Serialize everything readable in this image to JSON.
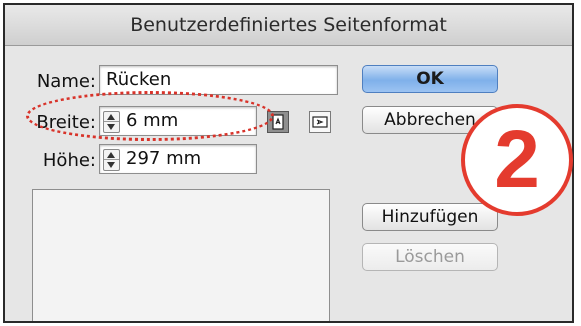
{
  "dialog": {
    "title": "Benutzerdefiniertes Seitenformat"
  },
  "form": {
    "name_label": "Name:",
    "name_value": "Rücken",
    "width_label": "Breite:",
    "width_value": "6 mm",
    "height_label": "Höhe:",
    "height_value": "297 mm"
  },
  "buttons": {
    "ok": "OK",
    "cancel": "Abbrechen",
    "add": "Hinzufügen",
    "delete": "Löschen"
  },
  "icons": {
    "orientation_portrait": "portrait-orientation-icon",
    "orientation_landscape": "landscape-orientation-icon",
    "stepper": "stepper-arrows-icon"
  },
  "annotation": {
    "badge_number": "2",
    "badge_color": "#e43b2e",
    "highlight_color": "#d8332a"
  },
  "colors": {
    "primary_button": "#7fb0ea",
    "dialog_background": "#e6e6e6"
  }
}
